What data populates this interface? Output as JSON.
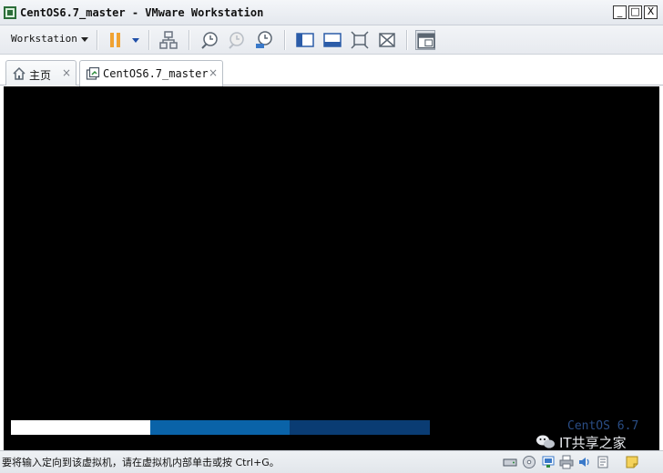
{
  "window": {
    "title": "CentOS6.7_master - VMware Workstation",
    "controls": {
      "minimize": "_",
      "maximize": "□",
      "close": "X"
    }
  },
  "toolbar": {
    "menu_label": "Workstation",
    "buttons": [
      "pause-icon",
      "dropdown-icon",
      "network-icon",
      "snapshot-take-icon",
      "snapshot-revert-icon",
      "snapshot-manager-icon",
      "console-view-icon",
      "quick-switch-icon",
      "fullscreen-icon",
      "unity-icon",
      "library-icon"
    ]
  },
  "tabs": [
    {
      "label": "主页",
      "icon": "home-icon",
      "close": "×",
      "active": false
    },
    {
      "label": "CentOS6.7_master",
      "icon": "vm-icon",
      "close": "×",
      "active": true
    }
  ],
  "vm": {
    "brand": "CentOS 6.7",
    "progress_segments": [
      {
        "color": "#ffffff",
        "fraction": 0.333
      },
      {
        "color": "#0a63a8",
        "fraction": 0.333
      },
      {
        "color": "#0a3c73",
        "fraction": 0.334
      }
    ]
  },
  "watermark": {
    "text": "IT共享之家",
    "icon": "wechat-icon"
  },
  "statusbar": {
    "hint": "要将输入定向到该虚拟机，请在虚拟机内部单击或按 Ctrl+G。",
    "devices": [
      "hard-disk-icon",
      "cd-rom-icon",
      "network-adapter-icon",
      "printer-icon",
      "sound-icon",
      "display-icon",
      "message-icon"
    ]
  },
  "colors": {
    "vm_background": "#000000",
    "brand": "#2a4d85",
    "accent": "#0a63a8"
  }
}
